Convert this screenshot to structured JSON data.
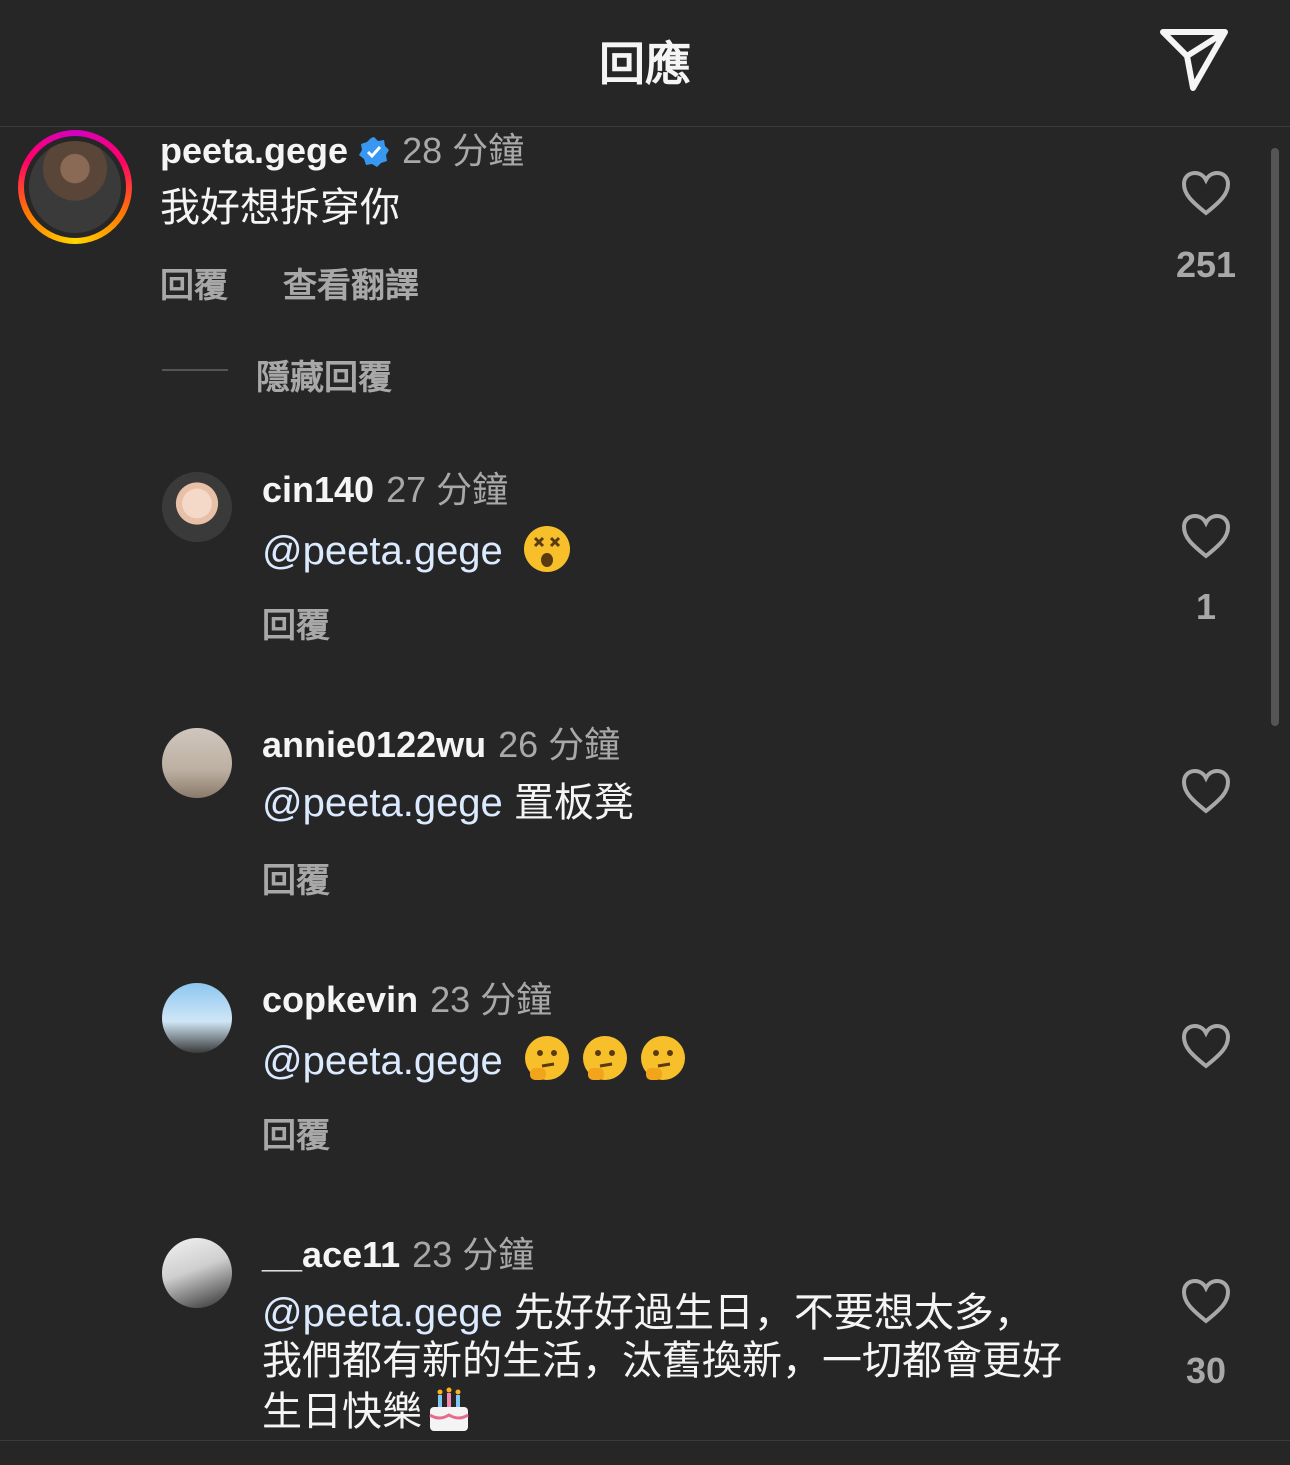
{
  "header": {
    "title": "回應"
  },
  "comment": {
    "username": "peeta.gege",
    "verified": true,
    "time": "28 分鐘",
    "text": "我好想拆穿你",
    "reply_label": "回覆",
    "translate_label": "查看翻譯",
    "likes": "251",
    "hide_replies_label": "隱藏回覆"
  },
  "replies": [
    {
      "username": "cin140",
      "time": "27 分鐘",
      "mention": "@peeta.gege",
      "text": "",
      "emoji": [
        "dizzy-face-emoji"
      ],
      "reply_label": "回覆",
      "likes": "1"
    },
    {
      "username": "annie0122wu",
      "time": "26 分鐘",
      "mention": "@peeta.gege",
      "text": "置板凳",
      "emoji": [],
      "reply_label": "回覆",
      "likes": ""
    },
    {
      "username": "copkevin",
      "time": "23 分鐘",
      "mention": "@peeta.gege",
      "text": "",
      "emoji": [
        "thinking-face-emoji",
        "thinking-face-emoji",
        "thinking-face-emoji"
      ],
      "reply_label": "回覆",
      "likes": ""
    },
    {
      "username": "__ace11",
      "time": "23 分鐘",
      "mention": "@peeta.gege",
      "text": "先好好過生日，不要想太多，",
      "text2": "我們都有新的生活，汰舊換新，一切都會更好",
      "text3": "生日快樂",
      "emoji": [
        "birthday-cake-emoji"
      ],
      "likes": "30"
    }
  ],
  "colors": {
    "background": "#262626",
    "secondary_text": "#a8a8a8",
    "verified_blue": "#3897f0"
  }
}
